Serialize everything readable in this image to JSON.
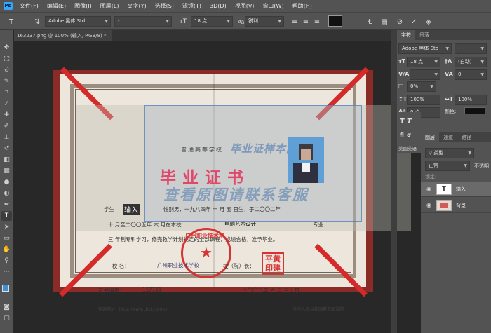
{
  "menubar": {
    "logo": "Ps",
    "items": [
      "文件(F)",
      "编辑(E)",
      "图像(I)",
      "图层(L)",
      "文字(Y)",
      "选择(S)",
      "滤镜(T)",
      "3D(D)",
      "视图(V)",
      "窗口(W)",
      "帮助(H)"
    ]
  },
  "options": {
    "font_family": "Adobe 黑体 Std",
    "font_style": "-",
    "font_size": "18 点",
    "anti_alias": "锐利",
    "text_color": "#111111"
  },
  "document": {
    "tab_title": "163237.png @ 100% (输入, RGB/8) *"
  },
  "certificate": {
    "header": "普通高等学校",
    "title": "毕业证书",
    "watermark_top": "毕业证样本网",
    "watermark_main": "查看原图请联系客服",
    "line1_prefix": "学生",
    "line1_input": "输入",
    "line1_rest": "性别男，一九八四年 十 月 五 日生，于二〇〇二年",
    "line2_a": "十 月至二〇〇五年 六 月在本校",
    "line2_major": "电脑艺术设计",
    "line2_b": "专业",
    "line3": "三 年制专科学习，修完教学计划规定的全部课程，成绩合格，准予毕业。",
    "principal_label": "校 名：",
    "school_name": "广州职业技术学校",
    "principal": "校（院）长：",
    "signature": "平黄印建",
    "cert_no_label": "证书编号：",
    "cert_no": "117731",
    "date": "二〇〇五年 六 月 三十日",
    "seal_text": "广州职业技术学",
    "footer_left": "查询网址：http://www.chsi.com.cn",
    "footer_right": "中华人民共和国教育部监制"
  },
  "char_panel": {
    "tabs": [
      "字符",
      "段落"
    ],
    "font_family": "Adobe 黑体 Std",
    "font_style": "-",
    "size": "18 点",
    "leading": "(自动)",
    "kerning": "",
    "tracking": "0",
    "scale_v": "100%",
    "scale_h": "100%",
    "baseline": "0 点",
    "color_label": "颜色:",
    "color": "#101010",
    "language": "美国英语"
  },
  "layers_panel": {
    "tabs": [
      "图层",
      "通道",
      "路径"
    ],
    "filter": "类型",
    "blend_mode": "正常",
    "opacity_label": "不透明",
    "lock_label": "锁定:",
    "layers": [
      {
        "name": "输入",
        "kind": "text",
        "selected": true
      },
      {
        "name": "背景",
        "kind": "image",
        "selected": false
      }
    ]
  }
}
